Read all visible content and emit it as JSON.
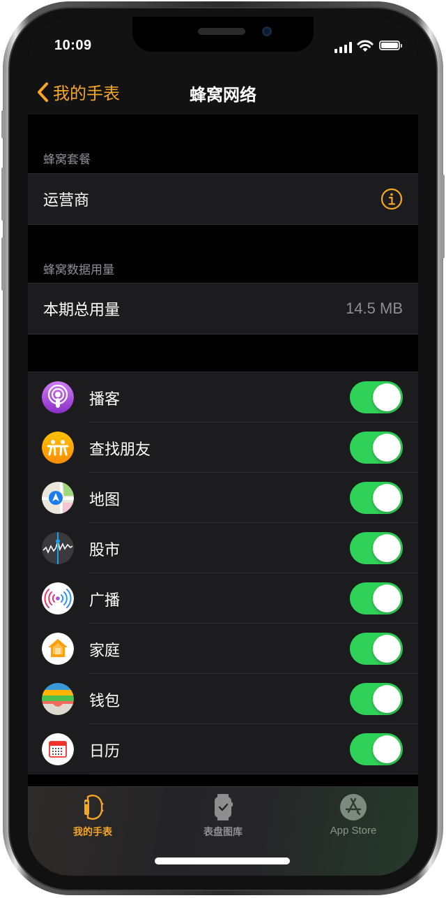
{
  "status_bar": {
    "time": "10:09",
    "icons": [
      "cellular-signal-icon",
      "wifi-icon",
      "battery-icon"
    ]
  },
  "nav": {
    "back_label": "我的手表",
    "back_icon": "chevron-left-icon",
    "title": "蜂窝网络"
  },
  "sections": [
    {
      "header": "蜂窝套餐",
      "cells": [
        {
          "label": "运营商",
          "accessory": "info-icon"
        }
      ]
    },
    {
      "header": "蜂窝数据用量",
      "cells": [
        {
          "label": "本期总用量",
          "value": "14.5 MB"
        }
      ]
    }
  ],
  "apps": [
    {
      "name": "播客",
      "icon": "podcasts-icon",
      "enabled": true
    },
    {
      "name": "查找朋友",
      "icon": "find-friends-icon",
      "enabled": true
    },
    {
      "name": "地图",
      "icon": "maps-icon",
      "enabled": true
    },
    {
      "name": "股市",
      "icon": "stocks-icon",
      "enabled": true
    },
    {
      "name": "广播",
      "icon": "radio-icon",
      "enabled": true
    },
    {
      "name": "家庭",
      "icon": "home-icon",
      "enabled": true
    },
    {
      "name": "钱包",
      "icon": "wallet-icon",
      "enabled": true
    },
    {
      "name": "日历",
      "icon": "calendar-icon",
      "enabled": true
    }
  ],
  "tabbar": {
    "tabs": [
      {
        "label": "我的手表",
        "icon": "my-watch-icon",
        "active": true
      },
      {
        "label": "表盘图库",
        "icon": "face-gallery-icon",
        "active": false
      },
      {
        "label": "App Store",
        "icon": "app-store-icon",
        "active": false
      }
    ]
  },
  "colors": {
    "accent": "#F5A623",
    "toggle_on": "#30D158",
    "background": "#000000",
    "cell_background": "#1C1C1E",
    "secondary_text": "#8E8E93",
    "inactive_tab": "#8E8E93"
  }
}
